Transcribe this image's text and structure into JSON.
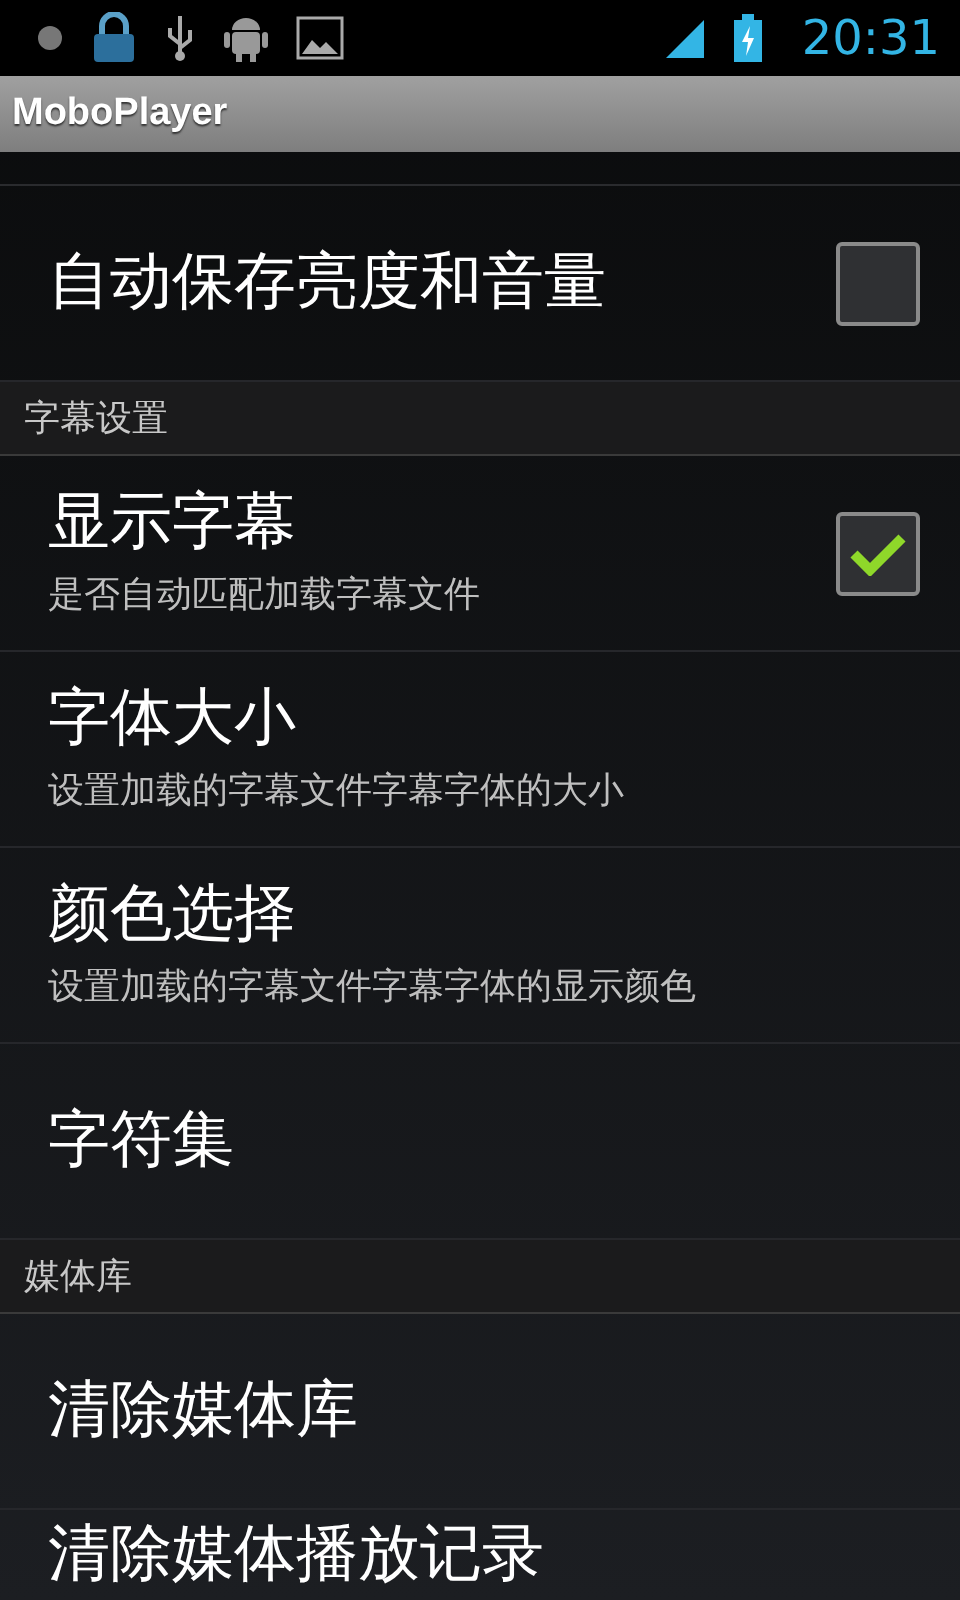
{
  "status_bar": {
    "time": "20:31"
  },
  "title_bar": {
    "title": "MoboPlayer"
  },
  "list": [
    {
      "kind": "checkbox",
      "title": "自动保存亮度和音量",
      "checked": false
    },
    {
      "kind": "header",
      "title": "字幕设置"
    },
    {
      "kind": "checkbox",
      "title": "显示字幕",
      "summary": "是否自动匹配加载字幕文件",
      "checked": true
    },
    {
      "kind": "plain",
      "title": "字体大小",
      "summary": "设置加载的字幕文件字幕字体的大小"
    },
    {
      "kind": "plain",
      "title": "颜色选择",
      "summary": "设置加载的字幕文件字幕字体的显示颜色"
    },
    {
      "kind": "plain",
      "title": "字符集"
    },
    {
      "kind": "header",
      "title": "媒体库"
    },
    {
      "kind": "plain",
      "title": "清除媒体库"
    },
    {
      "kind": "plain",
      "title": "清除媒体播放记录"
    }
  ]
}
